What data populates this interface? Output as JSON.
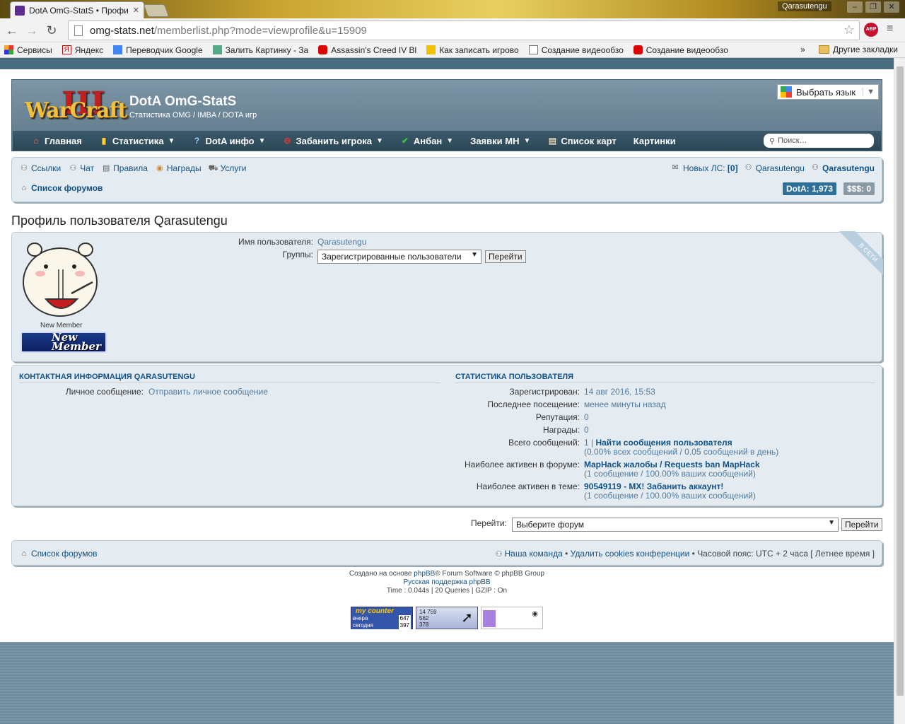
{
  "browser": {
    "tab_title": "DotA OmG-StatS • Профи",
    "window_user": "Qarasutengu",
    "url_host": "omg-stats.net",
    "url_path": "/memberlist.php?mode=viewprofile&u=15909",
    "abp_label": "ABP",
    "bookmarks": [
      "Сервисы",
      "Яндекс",
      "Переводчик Google",
      "Залить Картинку - За",
      "Assassin's Creed IV Bl",
      "Как записать игрово",
      "Создание видеообзо",
      "Создание видеообзо"
    ],
    "bookmarks_more": "»",
    "other_bookmarks": "Другие закладки"
  },
  "header": {
    "logo_text": "WarCraft",
    "logo_numeral": "III",
    "site_title": "DotA OmG-StatS",
    "site_desc": "Статистика OMG / IMBA / DOTA игр",
    "translate_label": "Выбрать язык"
  },
  "navbar": {
    "items": [
      "Главная",
      "Статистика",
      "DotA инфо",
      "Забанить игрока",
      "Анбан",
      "Заявки MH",
      "Список карт",
      "Картинки"
    ],
    "search_placeholder": "Поиск…"
  },
  "subnav": {
    "links": [
      "Ссылки",
      "Чат",
      "Правила",
      "Награды",
      "Услуги"
    ],
    "new_pm_label": "Новых ЛС:",
    "new_pm_count": "[0]",
    "user1": "Qarasutengu",
    "user2": "Qarasutengu",
    "breadcrumb": "Список форумов",
    "badge_dota": "DotA: 1,973",
    "badge_money": "$$$: 0"
  },
  "page_heading": "Профиль пользователя Qarasutengu",
  "profile": {
    "username_label": "Имя пользователя:",
    "username": "Qarasutengu",
    "groups_label": "Группы:",
    "groups_selected": "Зарегистрированные пользователи",
    "go_button": "Перейти",
    "rank_title": "New Member",
    "rank_image_text_1": "New",
    "rank_image_text_2": "Member",
    "online_label": "В СЕТИ"
  },
  "contact": {
    "title": "КОНТАКТНАЯ ИНФОРМАЦИЯ QARASUTENGU",
    "pm_label": "Личное сообщение:",
    "pm_link": "Отправить личное сообщение"
  },
  "stats": {
    "title": "СТАТИСТИКА ПОЛЬЗОВАТЕЛЯ",
    "registered_label": "Зарегистрирован:",
    "registered": "14 авг 2016, 15:53",
    "last_visit_label": "Последнее посещение:",
    "last_visit": "менее минуты назад",
    "reputation_label": "Репутация:",
    "reputation": "0",
    "awards_label": "Награды:",
    "awards": "0",
    "posts_label": "Всего сообщений:",
    "posts_count": "1 |",
    "posts_link": "Найти сообщения пользователя",
    "posts_detail": "(0.00% всех сообщений / 0.05 сообщений в день)",
    "active_forum_label": "Наиболее активен в форуме:",
    "active_forum": "MapHack жалобы / Requests ban MapHack",
    "active_forum_detail": "(1 сообщение / 100.00% ваших сообщений)",
    "active_topic_label": "Наиболее активен в теме:",
    "active_topic": "90549119 - MX! Забанить аккаунт!",
    "active_topic_detail": "(1 сообщение / 100.00% ваших сообщений)"
  },
  "jumpbox": {
    "label": "Перейти:",
    "selected": "Выберите форум",
    "button": "Перейти"
  },
  "footer_nav": {
    "index": "Список форумов",
    "team": "Наша команда",
    "sep": "•",
    "delete_cookies": "Удалить cookies конференции",
    "timezone": "Часовой пояс: UTC + 2 часа [ Летнее время ]"
  },
  "copyright": {
    "line1_pre": "Создано на основе",
    "line1_link": "phpBB",
    "line1_post": "® Forum Software © phpBB Group",
    "line2": "Русская поддержка phpBB",
    "line3": "Time : 0.044s | 20 Queries | GZIP : On"
  },
  "counters": {
    "c1_title": "my counter",
    "c1_row1_label": "вчера",
    "c1_row1_value": "647",
    "c1_row2_label": "сегодня",
    "c1_row2_value": "397",
    "c2_values": [
      "14 759",
      "562",
      "378"
    ]
  }
}
